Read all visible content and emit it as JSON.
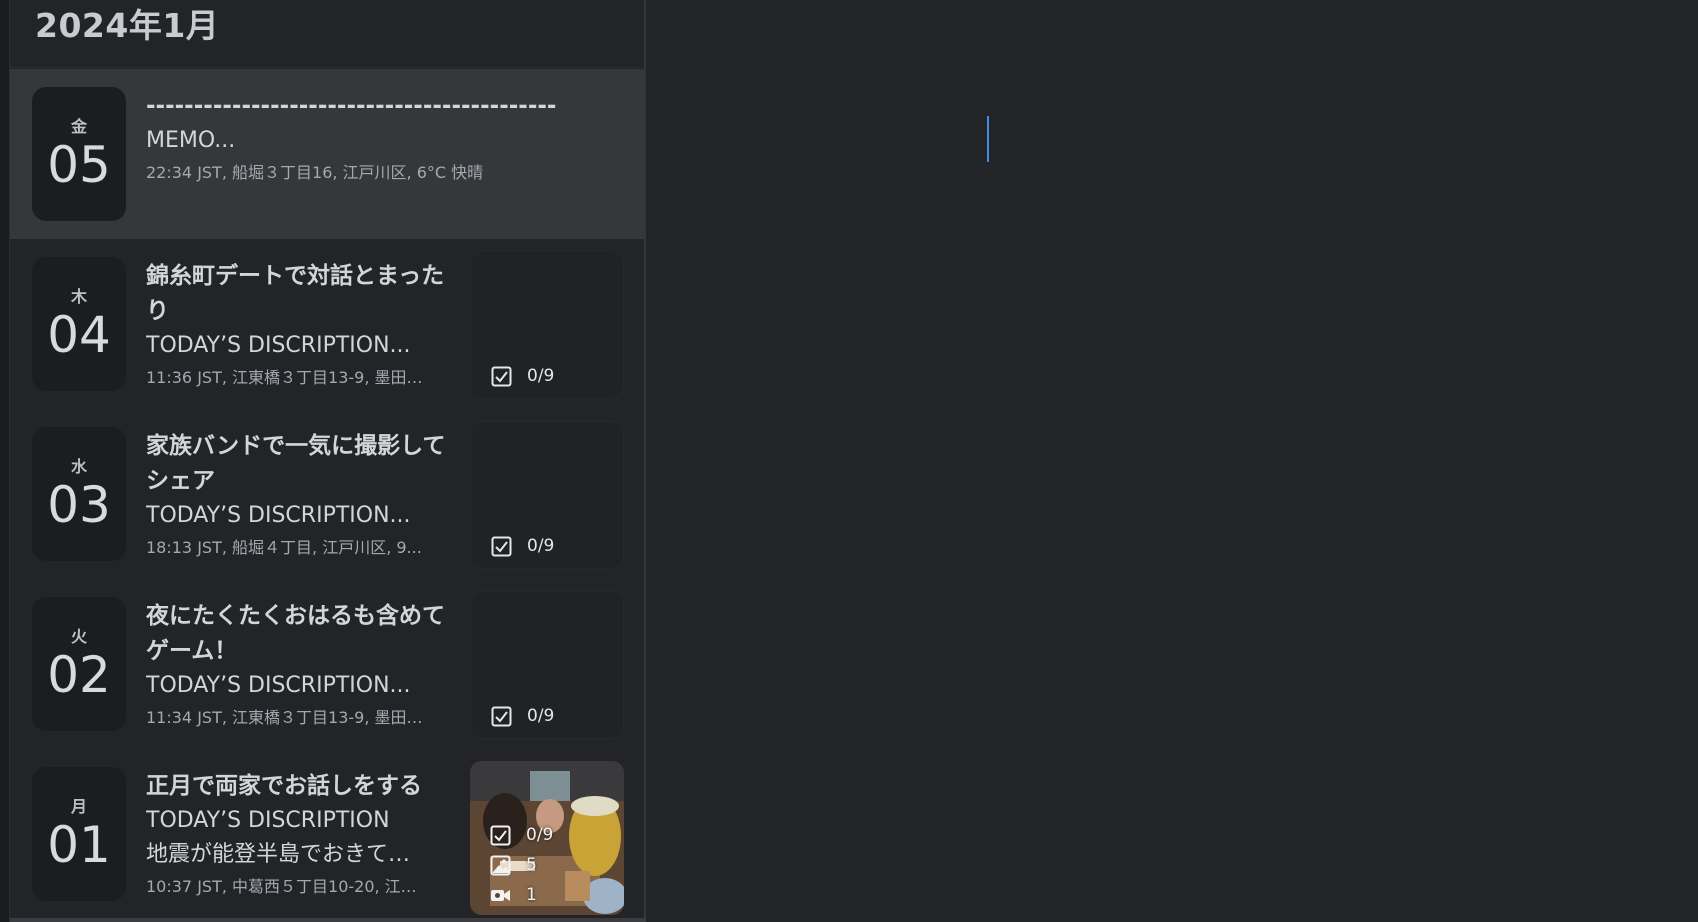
{
  "sidebar": {
    "month_title": "2024年1月",
    "entries": [
      {
        "weekday": "金",
        "day": "05",
        "title": "-------------------------------------------",
        "desc": "MEMO...",
        "meta": "22:34 JST,  船堀３丁目16, 江戸川区,  6°C 快晴",
        "selected": true
      },
      {
        "weekday": "木",
        "day": "04",
        "title": "錦糸町デートで対話とまったり",
        "desc": "TODAY’S DISCRIPTION...",
        "meta": "11:36 JST,  江東橋３丁目13-9, 墨田…",
        "tasks": "0/9"
      },
      {
        "weekday": "水",
        "day": "03",
        "title": "家族バンドで一気に撮影してシェア",
        "desc": "TODAY’S DISCRIPTION...",
        "meta": "18:13 JST,  船堀４丁目, 江戸川区,  9...",
        "tasks": "0/9"
      },
      {
        "weekday": "火",
        "day": "02",
        "title": "夜にたくたくおはるも含めてゲーム！",
        "desc": "TODAY’S DISCRIPTION...",
        "meta": "11:34 JST,  江東橋３丁目13-9, 墨田…",
        "tasks": "0/9"
      },
      {
        "weekday": "月",
        "day": "01",
        "title": "正月で両家でお話しをする",
        "desc": "TODAY’S DISCRIPTION",
        "desc2": "地震が能登半島でおきて…",
        "meta": "10:37 JST,  中葛西５丁目10-20, 江…",
        "tasks": "0/9",
        "photos": "5",
        "videos": "1"
      }
    ]
  },
  "icons": {
    "tasks": "checkbox-icon",
    "photos": "photo-icon",
    "videos": "video-camera-icon"
  },
  "colors": {
    "background": "#222428",
    "selected_row": "#35373b",
    "date_tile": "#1c1d21",
    "caret": "#3e8ee0"
  }
}
